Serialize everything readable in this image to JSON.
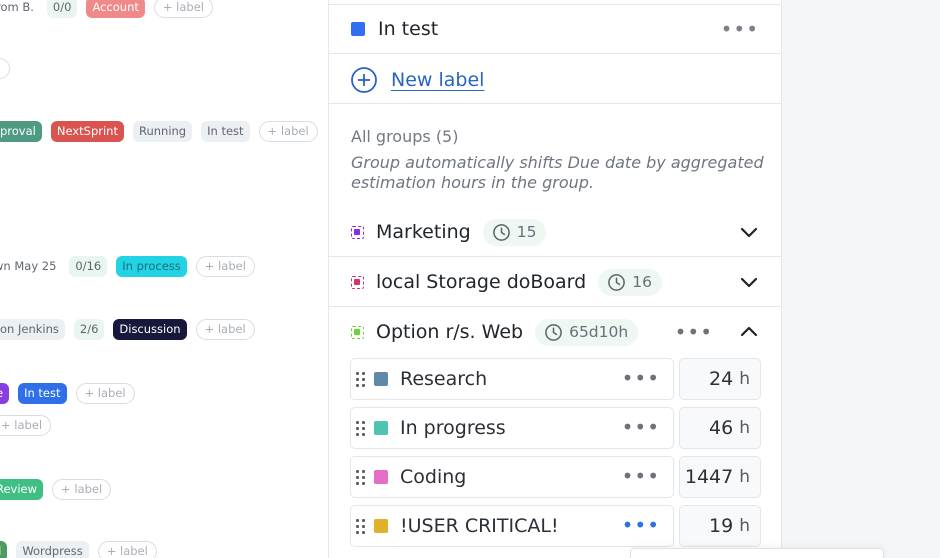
{
  "board": {
    "rows": [
      {
        "chips": [
          {
            "text": "rom B.",
            "kind": "plain"
          },
          {
            "text": "0/0",
            "kind": "count"
          },
          {
            "text": "Account",
            "kind": "label",
            "bg": "#f08a8a",
            "color": "#ffffff"
          },
          {
            "text": "+ label",
            "kind": "add"
          }
        ]
      },
      {
        "chips": [
          {
            "text": "",
            "kind": "ghost"
          }
        ]
      },
      {
        "chips": [
          {
            "text": "proval",
            "kind": "label",
            "bg": "#4f9a83",
            "color": "#ffffff"
          },
          {
            "text": "NextSprint",
            "kind": "label",
            "bg": "#d9534f",
            "color": "#ffffff"
          },
          {
            "text": "Running",
            "kind": "label",
            "bg": "#edf0f3",
            "color": "#5f6670"
          },
          {
            "text": "In test",
            "kind": "label",
            "bg": "#edf0f3",
            "color": "#5f6670"
          },
          {
            "text": "+ label",
            "kind": "add"
          }
        ]
      },
      {
        "chips": [
          {
            "text": "wn  May 25",
            "kind": "plain"
          },
          {
            "text": "0/16",
            "kind": "count"
          },
          {
            "text": "In process",
            "kind": "label",
            "bg": "#22d3e6",
            "color": "#1b6f78"
          },
          {
            "text": "+ label",
            "kind": "add"
          }
        ]
      },
      {
        "chips": [
          {
            "text": "on Jenkins",
            "kind": "label",
            "bg": "#edf0f3",
            "color": "#5f6670"
          },
          {
            "text": "2/6",
            "kind": "count"
          },
          {
            "text": "Discussion",
            "kind": "label",
            "bg": "#17183b",
            "color": "#ffffff"
          },
          {
            "text": "+ label",
            "kind": "add"
          }
        ]
      },
      {
        "chips": [
          {
            "text": "e",
            "kind": "label",
            "bg": "#8a3ee0",
            "color": "#ffffff"
          },
          {
            "text": "In test",
            "kind": "label",
            "bg": "#2f6fe8",
            "color": "#ffffff"
          },
          {
            "text": "+ label",
            "kind": "add"
          }
        ]
      },
      {
        "chips": [
          {
            "text": "+ label",
            "kind": "add"
          }
        ]
      },
      {
        "chips": [
          {
            "text": "Review",
            "kind": "label",
            "bg": "#3fbf84",
            "color": "#ffffff"
          },
          {
            "text": "+ label",
            "kind": "add"
          }
        ]
      },
      {
        "chips": [
          {
            "text": "d",
            "kind": "label",
            "bg": "#4f9a63",
            "color": "#ffffff"
          },
          {
            "text": "Wordpress",
            "kind": "label",
            "bg": "#edf0f3",
            "color": "#5f6670"
          },
          {
            "text": "+ label",
            "kind": "add"
          }
        ]
      }
    ]
  },
  "panel": {
    "current_label": {
      "name": "In test",
      "color": "#2f6ff0",
      "menu_icon": "more-horizontal-icon"
    },
    "new_label": {
      "text": "New label",
      "icon": "plus-circle-icon",
      "color": "#2b63c6"
    },
    "groups_title": "All groups (5)",
    "groups_hint": "Group automatically shifts Due date by aggregated estimation hours in the group.",
    "groups": [
      {
        "name": "Marketing",
        "duration": "15",
        "color": "#8a2be2",
        "expanded": false
      },
      {
        "name": "local Storage doBoard",
        "duration": "16",
        "color": "#d6336c",
        "expanded": false
      },
      {
        "name": "Option r/s. Web",
        "duration": "65d10h",
        "color": "#6bd434",
        "expanded": true
      }
    ],
    "items": [
      {
        "name": "Research",
        "color": "#5e89a8",
        "hours": "24",
        "unit": "h",
        "dots_color": "#6c727a"
      },
      {
        "name": "In progress",
        "color": "#4fc3b1",
        "hours": "46",
        "unit": "h",
        "dots_color": "#6c727a"
      },
      {
        "name": "Coding",
        "color": "#e46ec6",
        "hours": "1447",
        "unit": "h",
        "dots_color": "#6c727a"
      },
      {
        "name": "!USER CRITICAL!",
        "color": "#e0b12a",
        "hours": "19",
        "unit": "h",
        "dots_color": "#2f6fe8"
      }
    ]
  }
}
